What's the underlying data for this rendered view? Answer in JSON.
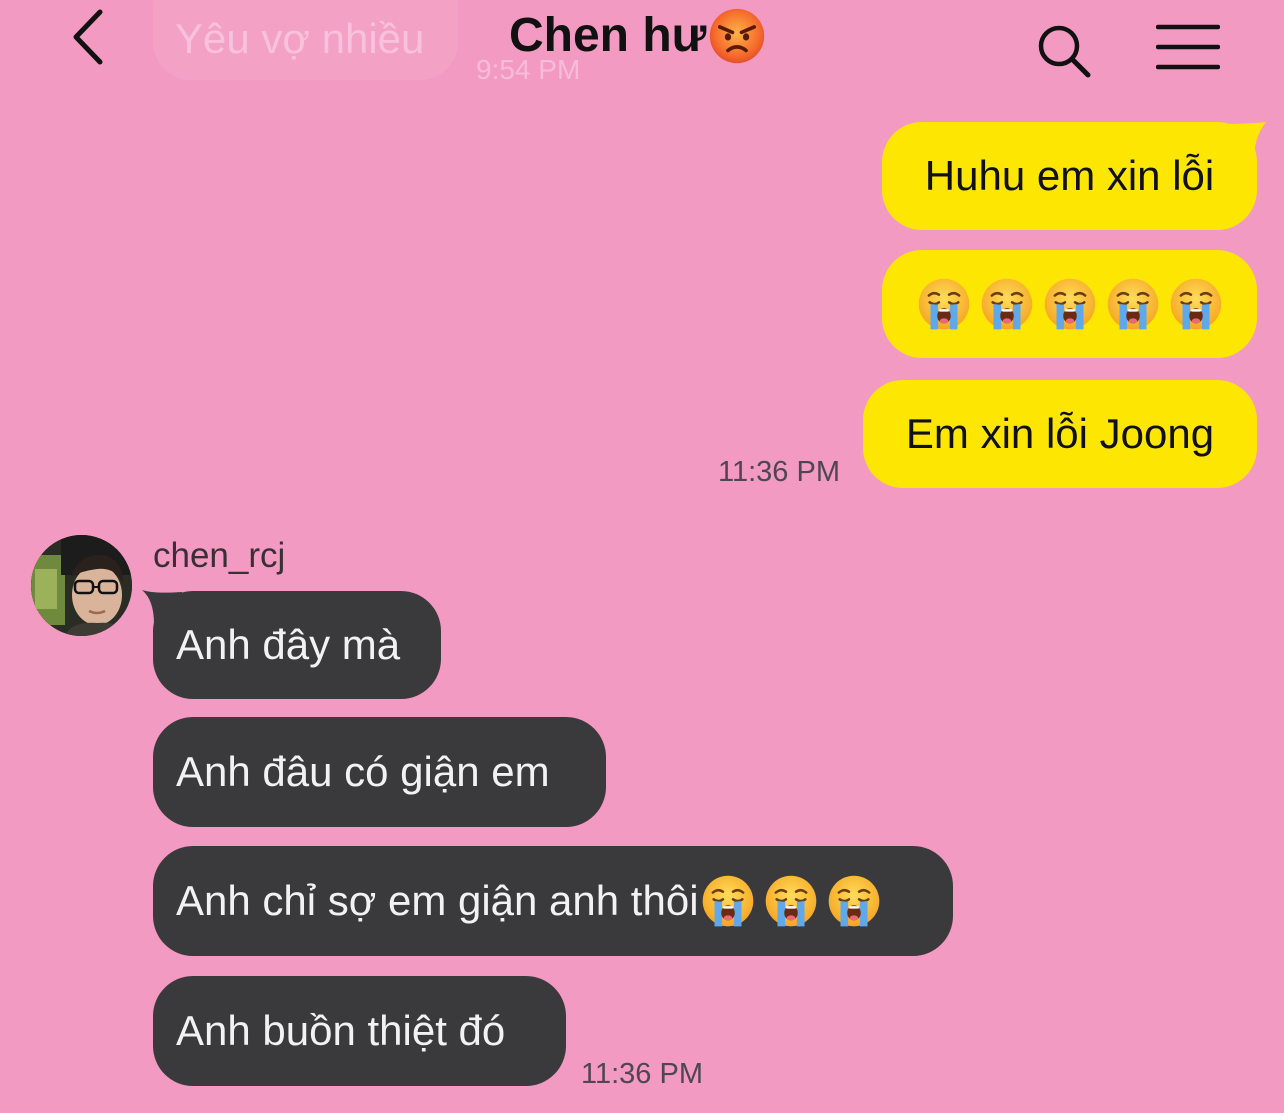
{
  "header": {
    "title": "Chen hư",
    "title_emoji": "angry-face-emoji",
    "back_icon": "chevron-left-icon",
    "search_icon": "search-icon",
    "menu_icon": "hamburger-menu-icon"
  },
  "previous_message": {
    "text": "Yêu vợ nhiều",
    "time": "9:54 PM"
  },
  "outgoing": {
    "messages": [
      "Huhu em xin lỗi",
      "😭😭😭😭😭",
      "Em xin lỗi Joong"
    ],
    "emoji_count": 5,
    "time": "11:36 PM"
  },
  "incoming": {
    "sender": "chen_rcj",
    "messages": [
      "Anh đây mà",
      "Anh đâu có giận em",
      "Anh chỉ sợ em giận anh thôi",
      "Anh buồn thiệt đó"
    ],
    "inline_emoji_count": 3,
    "time": "11:36 PM"
  },
  "colors": {
    "background": "#f39ac2",
    "outgoing_bubble": "#fee603",
    "incoming_bubble": "#3a3a3c"
  }
}
